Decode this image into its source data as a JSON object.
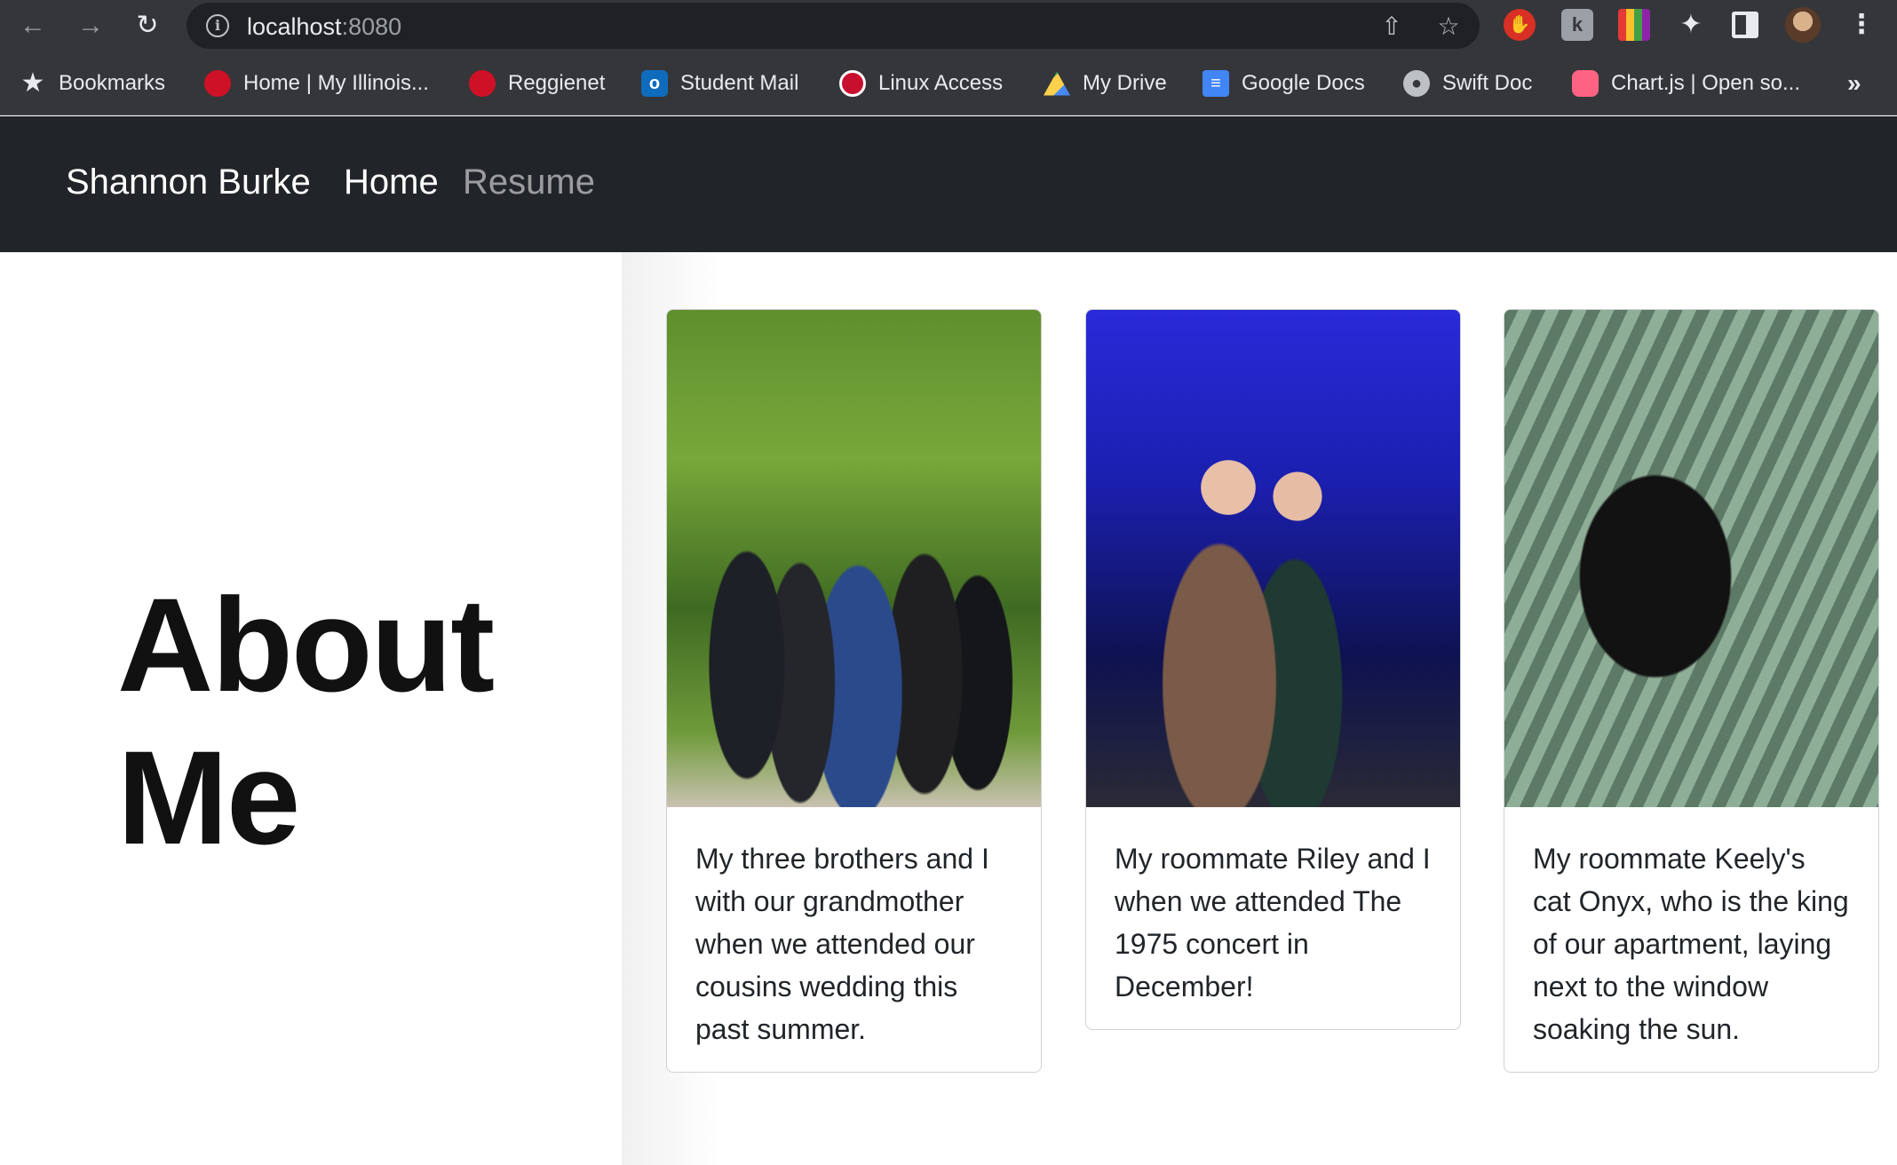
{
  "browser": {
    "url_host": "localhost",
    "url_port": ":8080",
    "bookmarks": [
      {
        "label": "Bookmarks",
        "icon": "star-icon"
      },
      {
        "label": "Home | My Illinois...",
        "icon": "redbird-icon"
      },
      {
        "label": "Reggienet",
        "icon": "redbird-icon"
      },
      {
        "label": "Student Mail",
        "icon": "outlook-icon"
      },
      {
        "label": "Linux Access",
        "icon": "university-seal-icon"
      },
      {
        "label": "My Drive",
        "icon": "google-drive-icon"
      },
      {
        "label": "Google Docs",
        "icon": "google-docs-icon"
      },
      {
        "label": "Swift Doc",
        "icon": "globe-icon"
      },
      {
        "label": "Chart.js | Open so...",
        "icon": "chartjs-icon"
      }
    ],
    "more_label": "»"
  },
  "navbar": {
    "brand": "Shannon Burke",
    "links": [
      {
        "label": "Home",
        "active": true
      },
      {
        "label": "Resume",
        "active": false
      }
    ]
  },
  "page": {
    "heading_line1": "About",
    "heading_line2": "Me"
  },
  "cards": [
    {
      "caption": "My three brothers and I with our grandmother when we attended our cousins wedding this past summer."
    },
    {
      "caption": "My roommate Riley and I when we attended The 1975 concert in December!"
    },
    {
      "caption": "My roommate Keely's cat Onyx, who is the king of our apartment, laying next to the window soaking the sun."
    }
  ]
}
